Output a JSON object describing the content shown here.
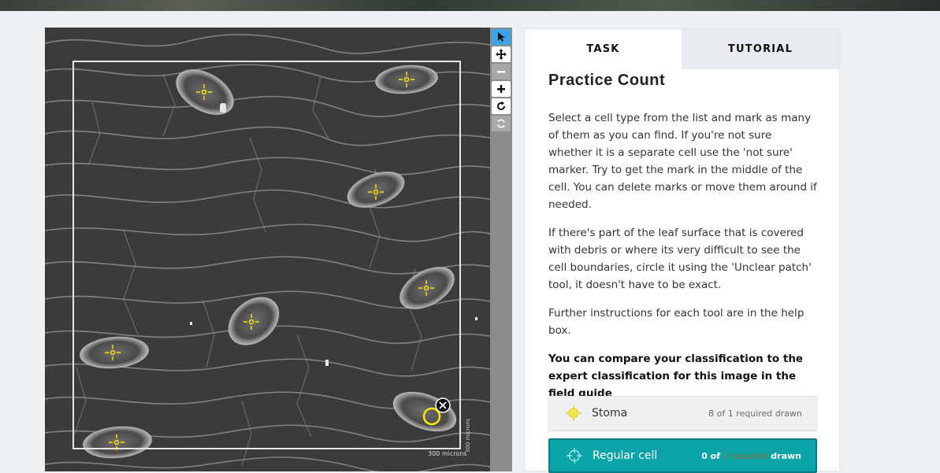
{
  "subject": {
    "scale_bar_label": "300 microns",
    "scale_bar_label_vertical": "300 microns",
    "marker_color": "#ffe600"
  },
  "toolbar": {
    "tools": [
      "pointer",
      "move",
      "zoom-out",
      "zoom-in",
      "rotate",
      "reset"
    ],
    "active_tool": "pointer"
  },
  "tabs": [
    {
      "label": "TASK",
      "active": true
    },
    {
      "label": "TUTORIAL",
      "active": false
    }
  ],
  "task": {
    "title": "Practice Count",
    "paragraphs": [
      "Select a cell type from the list and mark as many of them as you can find. If you're not sure whether it is a separate cell use the 'not sure' marker. Try to get the mark in the middle of the cell. You can delete marks or move them around if needed.",
      "If there's part of the leaf surface that is covered with debris or where its very difficult to see the cell boundaries, circle it using the 'Unclear patch' tool, it doesn't have to be exact.",
      "Further instructions for each tool are in the help box."
    ],
    "bold_paragraph": "You can compare your classification to the expert classification for this image in the field guide",
    "choices": [
      {
        "label": "Stoma",
        "count_text": "8 of 1 required drawn",
        "icon": "stoma-marker-icon",
        "selected": false
      },
      {
        "label": "Regular cell",
        "count_prefix": "0 of ",
        "count_faded": "1 required",
        "count_suffix": " drawn",
        "icon": "crosshair-icon",
        "selected": true
      }
    ]
  },
  "colors": {
    "accent_teal": "#0aa3a7",
    "active_tool": "#3aa2e6",
    "marker_yellow": "#ffe600"
  }
}
